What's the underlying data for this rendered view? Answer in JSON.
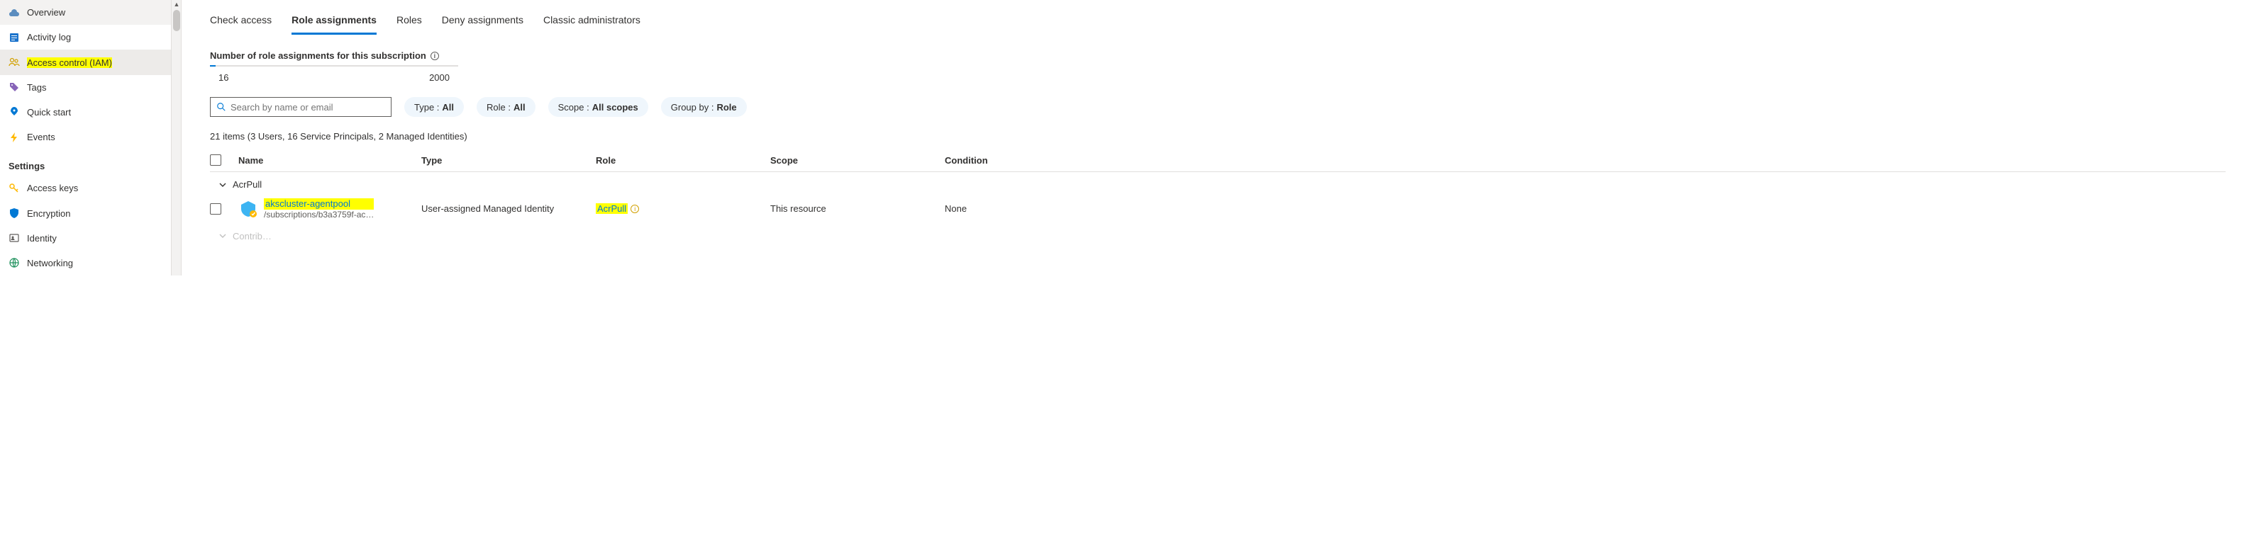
{
  "sidebar": {
    "items_top": [
      {
        "label": "Overview",
        "icon": "cloud-icon",
        "color": "#5b8dbf"
      },
      {
        "label": "Activity log",
        "icon": "log-icon",
        "color": "#1b73cc"
      },
      {
        "label": "Access control (IAM)",
        "icon": "people-icon",
        "color": "#d1a000",
        "highlighted": true,
        "selected": true
      },
      {
        "label": "Tags",
        "icon": "tag-icon",
        "color": "#8764b8"
      },
      {
        "label": "Quick start",
        "icon": "rocket-icon",
        "color": "#0078d4"
      },
      {
        "label": "Events",
        "icon": "bolt-icon",
        "color": "#ffb900"
      }
    ],
    "settings_header": "Settings",
    "items_settings": [
      {
        "label": "Access keys",
        "icon": "key-icon",
        "color": "#ffb900"
      },
      {
        "label": "Encryption",
        "icon": "shield-icon",
        "color": "#0078d4"
      },
      {
        "label": "Identity",
        "icon": "identity-icon",
        "color": "#605e5c"
      },
      {
        "label": "Networking",
        "icon": "network-icon",
        "color": "#1b8f5a"
      }
    ]
  },
  "tabs": [
    {
      "label": "Check access"
    },
    {
      "label": "Role assignments",
      "active": true
    },
    {
      "label": "Roles"
    },
    {
      "label": "Deny assignments"
    },
    {
      "label": "Classic administrators"
    }
  ],
  "quota": {
    "title": "Number of role assignments for this subscription",
    "used": "16",
    "limit": "2000"
  },
  "search": {
    "placeholder": "Search by name or email"
  },
  "filters": {
    "type": {
      "label": "Type : ",
      "value": "All"
    },
    "role": {
      "label": "Role : ",
      "value": "All"
    },
    "scope": {
      "label": "Scope : ",
      "value": "All scopes"
    },
    "groupby": {
      "label": "Group by : ",
      "value": "Role"
    }
  },
  "summary": "21 items (3 Users, 16 Service Principals, 2 Managed Identities)",
  "columns": {
    "name": "Name",
    "type": "Type",
    "role": "Role",
    "scope": "Scope",
    "condition": "Condition"
  },
  "groups": [
    {
      "role_name": "AcrPull",
      "rows": [
        {
          "name": "akscluster-agentpool",
          "sub": "/subscriptions/b3a3759f-ac…",
          "type": "User-assigned Managed Identity",
          "role": "AcrPull",
          "scope": "This resource",
          "condition": "None"
        }
      ]
    },
    {
      "role_name": "Contributor",
      "collapsed": true
    }
  ]
}
